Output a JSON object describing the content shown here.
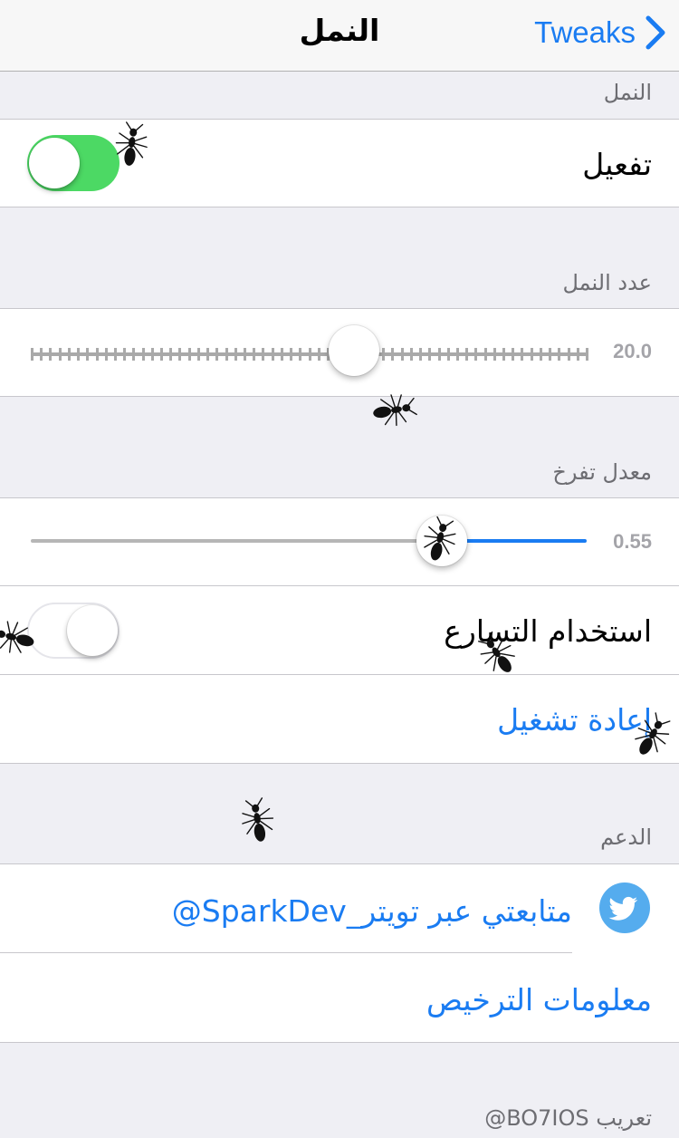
{
  "navbar": {
    "title": "النمل",
    "back_label": "Tweaks"
  },
  "ants_section": {
    "header": "النمل",
    "enable_label": "تفعيل",
    "enable_on": true
  },
  "count_section": {
    "header": "عدد النمل",
    "value_text": "20.0",
    "level": 0.58
  },
  "rate_section": {
    "header": "معدل تفرخ",
    "value_text": "0.55",
    "level": 0.55,
    "acceleration_label": "استخدام التسارع",
    "acceleration_on": false,
    "restart_label": "إعادة تشغيل"
  },
  "support_section": {
    "header": "الدعم",
    "twitter_label": "متابعتي عبر تويتر_SparkDev@",
    "license_label": "معلومات الترخيص"
  },
  "footer": {
    "credit": "تعريب BO7IOS@"
  },
  "colors": {
    "accent": "#1a7cf2",
    "switch_on": "#4cd964",
    "twitter": "#55acee"
  },
  "icons": {
    "back": "chevron-right-icon",
    "twitter": "twitter-bird-icon",
    "decor": "ant-icon"
  }
}
